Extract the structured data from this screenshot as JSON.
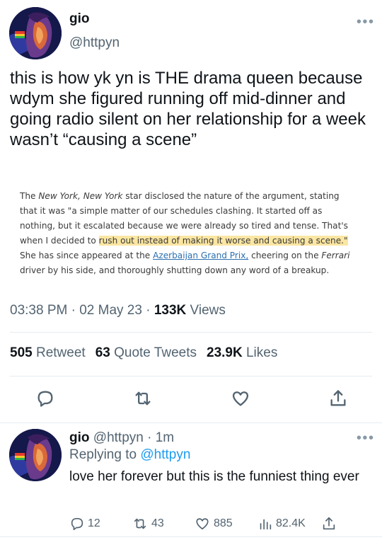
{
  "tweet": {
    "display_name": "gio",
    "handle": "@httpyn",
    "text": "this is how yk yn is THE drama queen because wdym she figured running off mid-dinner and going radio silent on her relationship for a week wasn’t “causing a scene”",
    "article": {
      "p1": "The ",
      "p1_italic1": "New York, New York",
      "p2": " star disclosed the nature of the argument, stating that it was \"a simple matter of our schedules clashing. It started off as nothing, but it escalated because we were already so tired and tense. That's when I decided to ",
      "highlight": "rush out instead of making it worse and causing a scene.\"",
      "p3": " She has since appeared at the ",
      "link": "Azerbaijan Grand Prix,",
      "p4": " cheering on the ",
      "p4_italic": "Ferrari",
      "p5": " driver by his side, and thoroughly shutting down any word of a breakup."
    },
    "time": "03:38 PM",
    "sep1": " · ",
    "date": "02 May 23",
    "sep2": " · ",
    "views_count": "133K",
    "views_label": " Views",
    "retweets_count": "505",
    "retweets_label": " Retweet",
    "quotes_count": "63",
    "quotes_label": " Quote Tweets",
    "likes_count": "23.9K",
    "likes_label": " Likes"
  },
  "reply": {
    "display_name": "gio",
    "handle_time": " @httpyn · 1m",
    "replying_prefix": "Replying to ",
    "replying_mention": "@httpyn",
    "text": "love her forever but this is the funniest thing ever",
    "replies": "12",
    "retweets": "43",
    "likes": "885",
    "views": "82.4K"
  },
  "icons": {
    "more": "more-horizontal-icon",
    "reply": "reply-icon",
    "retweet": "retweet-icon",
    "like": "heart-icon",
    "share": "share-icon",
    "views": "views-bar-icon"
  },
  "colors": {
    "text": "#0f1419",
    "secondary": "#536471",
    "link": "#1d9bf0",
    "highlight": "#fbe6a2",
    "divider": "#e6ecf0"
  }
}
